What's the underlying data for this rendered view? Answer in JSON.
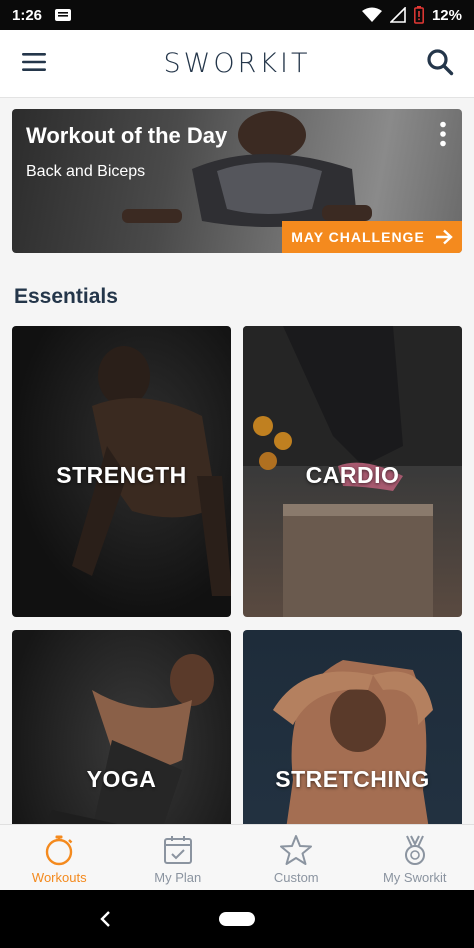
{
  "status_bar": {
    "time": "1:26",
    "battery": "12%"
  },
  "app_bar": {
    "logo_text": "SWORKIT"
  },
  "workout_of_day": {
    "title": "Workout of the Day",
    "subtitle": "Back and Biceps",
    "challenge_label": "MAY CHALLENGE"
  },
  "essentials": {
    "heading": "Essentials",
    "tiles": [
      {
        "label": "STRENGTH"
      },
      {
        "label": "CARDIO"
      },
      {
        "label": "YOGA"
      },
      {
        "label": "STRETCHING"
      }
    ]
  },
  "bottom_nav": {
    "items": [
      {
        "label": "Workouts",
        "icon": "stopwatch-icon",
        "active": true
      },
      {
        "label": "My Plan",
        "icon": "calendar-check-icon",
        "active": false
      },
      {
        "label": "Custom",
        "icon": "star-icon",
        "active": false
      },
      {
        "label": "My Sworkit",
        "icon": "medal-icon",
        "active": false
      }
    ]
  },
  "colors": {
    "accent": "#f48a1e",
    "navy": "#24364a",
    "inactive": "#8b94a0"
  }
}
